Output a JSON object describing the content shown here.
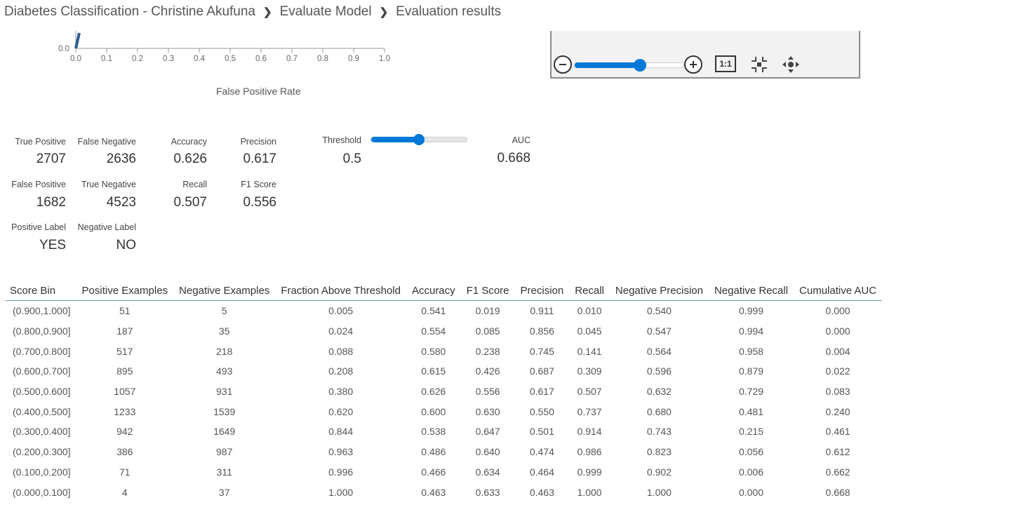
{
  "breadcrumb": {
    "experiment": "Diabetes Classification - Christine Akufuna",
    "module": "Evaluate Model",
    "page": "Evaluation results"
  },
  "roc_chart": {
    "x_axis_label": "False Positive Rate",
    "y_tick_visible": "0.0",
    "x_ticks": [
      "0.0",
      "0.1",
      "0.2",
      "0.3",
      "0.4",
      "0.5",
      "0.6",
      "0.7",
      "0.8",
      "0.9",
      "1.0"
    ],
    "curve_color": "#2f5c8f"
  },
  "zoom_toolbar": {
    "zoom_out_icon": "minus-circle-icon",
    "zoom_in_icon": "plus-circle-icon",
    "actual_size_label": "1:1",
    "fit_icon": "fit-to-screen-icon",
    "pan_icon": "pan-icon",
    "zoom_level": 0.6
  },
  "metrics": {
    "true_positive": {
      "label": "True Positive",
      "value": "2707"
    },
    "false_negative": {
      "label": "False Negative",
      "value": "2636"
    },
    "accuracy": {
      "label": "Accuracy",
      "value": "0.626"
    },
    "precision": {
      "label": "Precision",
      "value": "0.617"
    },
    "threshold": {
      "label": "Threshold",
      "value": "0.5"
    },
    "auc": {
      "label": "AUC",
      "value": "0.668"
    },
    "false_positive": {
      "label": "False Positive",
      "value": "1682"
    },
    "true_negative": {
      "label": "True Negative",
      "value": "4523"
    },
    "recall": {
      "label": "Recall",
      "value": "0.507"
    },
    "f1_score": {
      "label": "F1 Score",
      "value": "0.556"
    },
    "positive_label": {
      "label": "Positive Label",
      "value": "YES"
    },
    "negative_label": {
      "label": "Negative Label",
      "value": "NO"
    }
  },
  "threshold_slider": {
    "fraction": 0.5,
    "accent": "#0078d7"
  },
  "table": {
    "headers": [
      "Score Bin",
      "Positive Examples",
      "Negative Examples",
      "Fraction Above Threshold",
      "Accuracy",
      "F1 Score",
      "Precision",
      "Recall",
      "Negative Precision",
      "Negative Recall",
      "Cumulative AUC"
    ],
    "rows": [
      [
        "(0.900,1.000]",
        "51",
        "5",
        "0.005",
        "0.541",
        "0.019",
        "0.911",
        "0.010",
        "0.540",
        "0.999",
        "0.000"
      ],
      [
        "(0.800,0.900]",
        "187",
        "35",
        "0.024",
        "0.554",
        "0.085",
        "0.856",
        "0.045",
        "0.547",
        "0.994",
        "0.000"
      ],
      [
        "(0.700,0.800]",
        "517",
        "218",
        "0.088",
        "0.580",
        "0.238",
        "0.745",
        "0.141",
        "0.564",
        "0.958",
        "0.004"
      ],
      [
        "(0.600,0.700]",
        "895",
        "493",
        "0.208",
        "0.615",
        "0.426",
        "0.687",
        "0.309",
        "0.596",
        "0.879",
        "0.022"
      ],
      [
        "(0.500,0.600]",
        "1057",
        "931",
        "0.380",
        "0.626",
        "0.556",
        "0.617",
        "0.507",
        "0.632",
        "0.729",
        "0.083"
      ],
      [
        "(0.400,0.500]",
        "1233",
        "1539",
        "0.620",
        "0.600",
        "0.630",
        "0.550",
        "0.737",
        "0.680",
        "0.481",
        "0.240"
      ],
      [
        "(0.300,0.400]",
        "942",
        "1649",
        "0.844",
        "0.538",
        "0.647",
        "0.501",
        "0.914",
        "0.743",
        "0.215",
        "0.461"
      ],
      [
        "(0.200,0.300]",
        "386",
        "987",
        "0.963",
        "0.486",
        "0.640",
        "0.474",
        "0.986",
        "0.823",
        "0.056",
        "0.612"
      ],
      [
        "(0.100,0.200]",
        "71",
        "311",
        "0.996",
        "0.466",
        "0.634",
        "0.464",
        "0.999",
        "0.902",
        "0.006",
        "0.662"
      ],
      [
        "(0.000,0.100]",
        "4",
        "37",
        "1.000",
        "0.463",
        "0.633",
        "0.463",
        "1.000",
        "1.000",
        "0.000",
        "0.668"
      ]
    ]
  }
}
